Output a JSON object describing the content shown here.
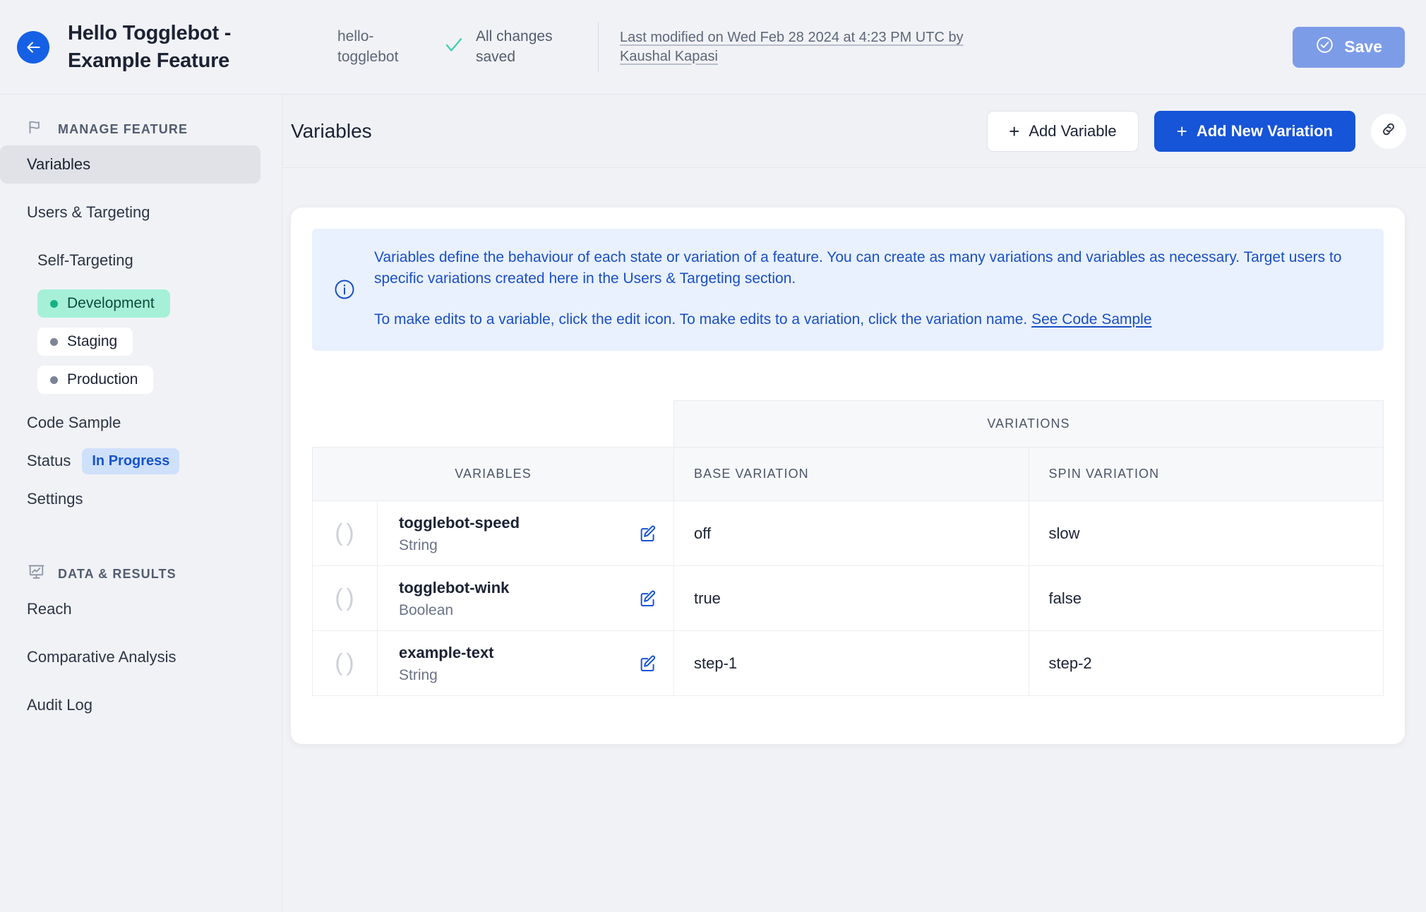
{
  "header": {
    "back_icon": "arrow-left-icon",
    "title": "Hello Togglebot - Example Feature",
    "feature_key": "hello-togglebot",
    "saved_status": "All changes saved",
    "saved_icon": "check-icon",
    "last_modified": "Last modified on Wed Feb 28 2024 at 4:23 PM UTC by Kaushal Kapasi",
    "save_label": "Save",
    "save_icon": "check-circle-icon",
    "accent_blue": "#1560e5",
    "save_button_color": "#7d9ce8"
  },
  "sidebar": {
    "manage_feature": {
      "label": "MANAGE FEATURE",
      "icon": "flag-icon"
    },
    "items": [
      {
        "label": "Variables",
        "active": true
      },
      {
        "label": "Users & Targeting",
        "active": false
      },
      {
        "label": "Self-Targeting",
        "active": false
      }
    ],
    "environments": [
      {
        "label": "Development",
        "state": "active",
        "dot_color": "#17b085"
      },
      {
        "label": "Staging",
        "state": "inactive",
        "dot_color": "#7b8495"
      },
      {
        "label": "Production",
        "state": "inactive",
        "dot_color": "#7b8495"
      }
    ],
    "code_sample": "Code Sample",
    "status_label": "Status",
    "status_value": "In Progress",
    "status_color": "#1654cd",
    "settings": "Settings",
    "data_results": {
      "label": "DATA & RESULTS",
      "icon": "chart-presentation-icon"
    },
    "data_items": [
      {
        "label": "Reach"
      },
      {
        "label": "Comparative Analysis"
      },
      {
        "label": "Audit Log"
      }
    ]
  },
  "main": {
    "title": "Variables",
    "add_variable_label": "Add Variable",
    "add_variation_label": "Add New Variation",
    "plus_glyph": "+",
    "link_icon": "link-chain-icon",
    "primary_button_color": "#1654d8"
  },
  "info": {
    "icon": "info-circle-icon",
    "paragraph_1": "Variables define the behaviour of each state or variation of a feature. You can create as many variations and variables as necessary. Target users to specific variations created here in the Users & Targeting section.",
    "paragraph_2_prefix": "To make edits to a variable, click the edit icon. To make edits to a variation, click the variation name. ",
    "link_label": "See Code Sample",
    "banner_bg": "#e9f1fe",
    "text_color": "#1a4fc4"
  },
  "table": {
    "group_header": "VARIATIONS",
    "columns": [
      "VARIABLES",
      "BASE VARIATION",
      "SPIN VARIATION"
    ],
    "rows": [
      {
        "type_icon": "parentheses-icon",
        "name": "togglebot-speed",
        "type": "String",
        "edit_icon": "edit-pencil-icon",
        "base": "off",
        "spin": "slow"
      },
      {
        "type_icon": "parentheses-icon",
        "name": "togglebot-wink",
        "type": "Boolean",
        "edit_icon": "edit-pencil-icon",
        "base": "true",
        "spin": "false"
      },
      {
        "type_icon": "parentheses-icon",
        "name": "example-text",
        "type": "String",
        "edit_icon": "edit-pencil-icon",
        "base": "step-1",
        "spin": "step-2"
      }
    ]
  }
}
